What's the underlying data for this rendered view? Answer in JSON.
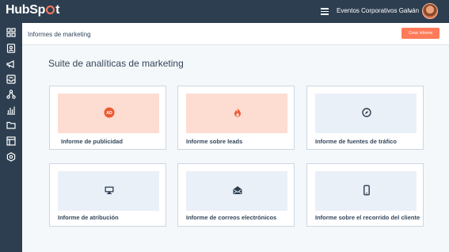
{
  "topbar": {
    "logo_left": "HubSp",
    "logo_right": "t",
    "account_name": "Eventos Corporativos Galván",
    "chevron": "⌄"
  },
  "sidebar": {
    "icons": [
      "grid-icon",
      "contacts-icon",
      "megaphone-icon",
      "inbox-icon",
      "network-icon",
      "bar-chart-icon",
      "folder-icon",
      "layout-icon",
      "settings-hexagon-icon"
    ],
    "active_index": 3
  },
  "header": {
    "title": "Informes de marketing",
    "create_label": "Crear informe"
  },
  "main": {
    "title": "Suite de analíticas de marketing",
    "cards": [
      {
        "label": "Informe de publicidad",
        "icon": "ads-badge-icon",
        "badge": "AD",
        "tint": "pink"
      },
      {
        "label": "Informe sobre leads",
        "icon": "flame-icon",
        "tint": "pink"
      },
      {
        "label": "Informe de fuentes de tráfico",
        "icon": "compass-icon",
        "tint": "lavender"
      },
      {
        "label": "Informe de atribución",
        "icon": "monitor-icon",
        "tint": "lavender"
      },
      {
        "label": "Informe de correos electrónicos",
        "icon": "envelope-icon",
        "tint": "lavender"
      },
      {
        "label": "Informe sobre el recorrido del cliente",
        "icon": "mobile-icon",
        "tint": "lavender"
      }
    ]
  },
  "colors": {
    "nav": "#2d3e50",
    "accent": "#ff7a59",
    "text": "#33475b",
    "icon": "#2d3e50"
  }
}
